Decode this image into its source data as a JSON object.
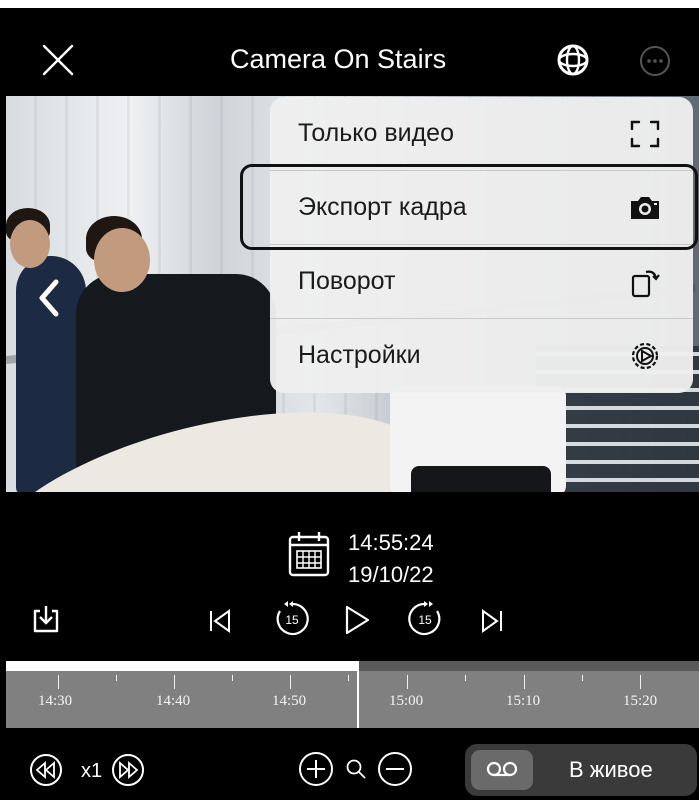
{
  "header": {
    "title": "Camera On Stairs",
    "close_icon": "close-icon",
    "ptz_icon": "ptz-icon",
    "more_icon": "more-icon"
  },
  "menu": {
    "items": [
      {
        "label": "Только видео",
        "icon": "fullscreen-icon"
      },
      {
        "label": "Экспорт кадра",
        "icon": "camera-icon",
        "highlighted": true
      },
      {
        "label": "Поворот",
        "icon": "rotate-icon"
      },
      {
        "label": "Настройки",
        "icon": "settings-icon"
      }
    ]
  },
  "playback": {
    "time": "14:55:24",
    "date": "19/10/22",
    "skip_seconds": "15"
  },
  "timeline": {
    "labels": [
      "14:30",
      "14:40",
      "14:50",
      "15:00",
      "15:10",
      "15:20"
    ],
    "played_fraction": 0.51
  },
  "bottom": {
    "speed": "x1",
    "live_label": "В живое"
  },
  "colors": {
    "background": "#000000",
    "menu_bg": "#eeeeee",
    "timeline_bg": "#808080",
    "live_pill": "#3a3a3a",
    "top_link": "#1a5fd0"
  }
}
